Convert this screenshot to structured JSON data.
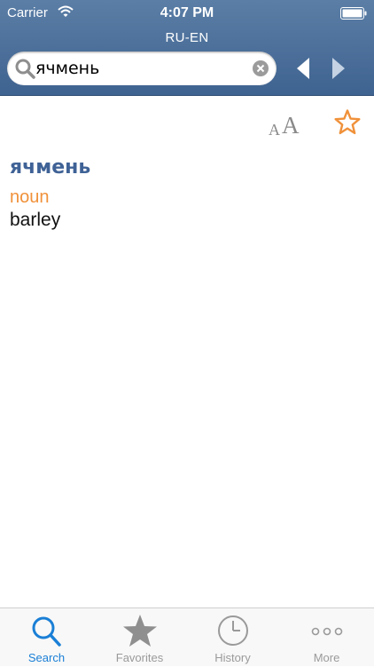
{
  "status_bar": {
    "carrier": "Carrier",
    "time": "4:07 PM"
  },
  "nav": {
    "title": "RU-EN"
  },
  "search": {
    "value": "ячмень"
  },
  "entry": {
    "headword": "ячмень",
    "part_of_speech": "noun",
    "translation": "barley"
  },
  "tabs": [
    {
      "label": "Search",
      "icon": "search-icon",
      "active": true
    },
    {
      "label": "Favorites",
      "icon": "star-icon",
      "active": false
    },
    {
      "label": "History",
      "icon": "clock-icon",
      "active": false
    },
    {
      "label": "More",
      "icon": "more-dots-icon",
      "active": false
    }
  ],
  "colors": {
    "header": "#4a6e98",
    "headword": "#3f6296",
    "part_of_speech": "#f0913a",
    "accent_star": "#f0913a",
    "active_tab": "#1a7fd6"
  }
}
